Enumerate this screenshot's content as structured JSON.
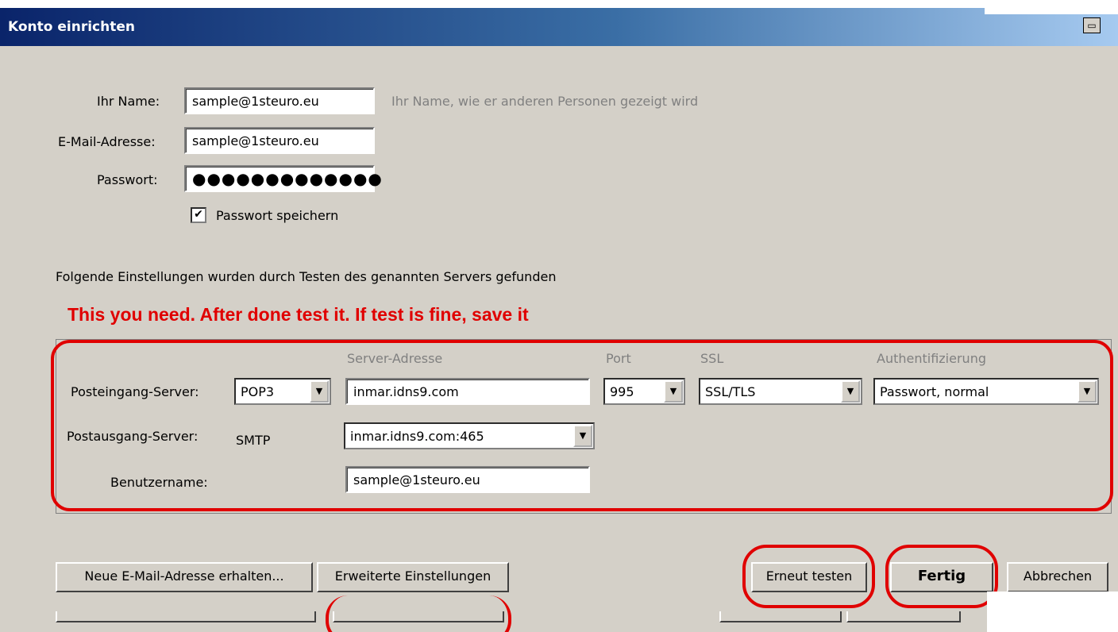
{
  "window": {
    "title": "Konto einrichten"
  },
  "form": {
    "name_label": "Ihr Name:",
    "name_value": "sample@1steuro.eu",
    "name_hint": "Ihr Name, wie er anderen Personen gezeigt wird",
    "email_label": "E-Mail-Adresse:",
    "email_value": "sample@1steuro.eu",
    "password_label": "Passwort:",
    "password_value": "●●●●●●●●●●●●●",
    "save_password_label": "Passwort speichern",
    "save_password_checked": true
  },
  "info_text": "Folgende Einstellungen wurden durch Testen des genannten Servers gefunden",
  "annotation": "This you need. After done test it. If test is fine, save it",
  "servers": {
    "col_address": "Server-Adresse",
    "col_port": "Port",
    "col_ssl": "SSL",
    "col_auth": "Authentifizierung",
    "incoming_label": "Posteingang-Server:",
    "incoming_protocol": "POP3",
    "incoming_address": "inmar.idns9.com",
    "incoming_port": "995",
    "incoming_ssl": "SSL/TLS",
    "incoming_auth": "Passwort, normal",
    "outgoing_label": "Postausgang-Server:",
    "outgoing_protocol": "SMTP",
    "outgoing_address": "inmar.idns9.com:465",
    "username_label": "Benutzername:",
    "username_value": "sample@1steuro.eu"
  },
  "buttons": {
    "new_email": "Neue E-Mail-Adresse erhalten...",
    "advanced": "Erweiterte Einstellungen",
    "retest": "Erneut testen",
    "done": "Fertig",
    "cancel": "Abbrechen"
  },
  "colors": {
    "annotation_red": "#e00000",
    "titlebar_start": "#0a246a",
    "window_bg": "#d4d0c8"
  }
}
